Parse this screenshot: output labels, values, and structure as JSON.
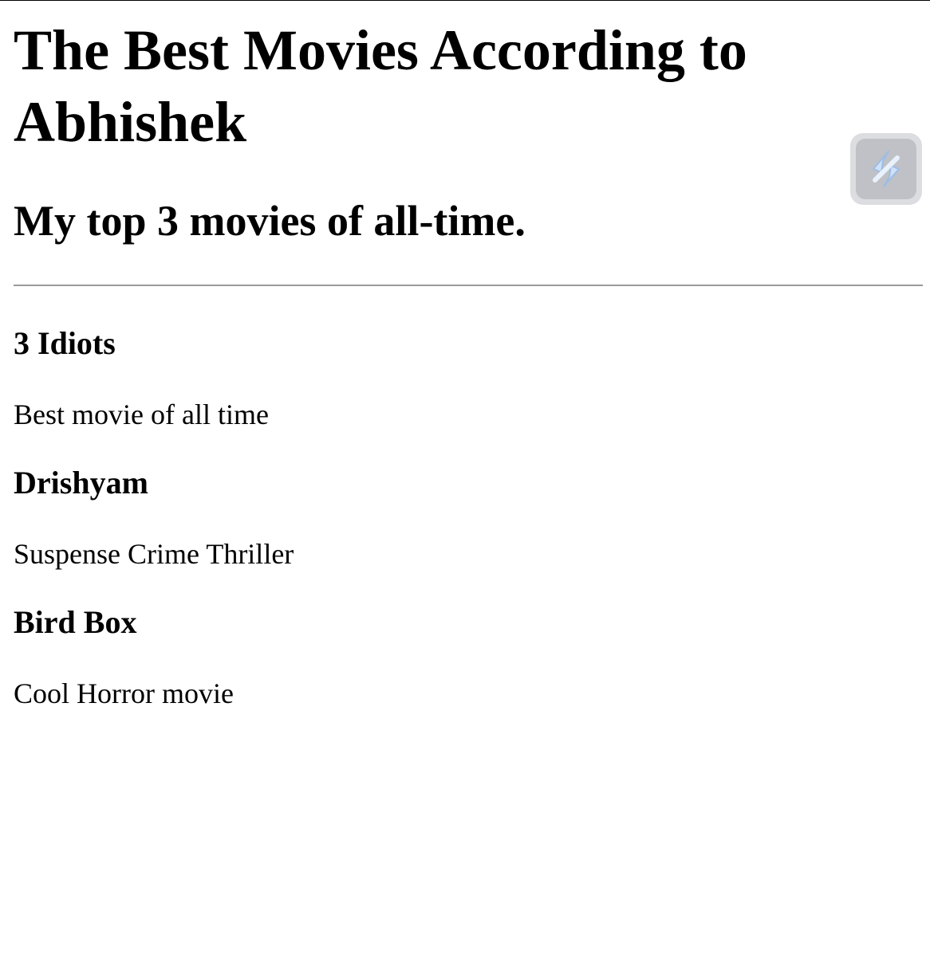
{
  "page": {
    "title": "The Best Movies According to Abhishek",
    "subtitle": "My top 3 movies of all-time."
  },
  "movies": [
    {
      "title": "3 Idiots",
      "description": "Best movie of all time"
    },
    {
      "title": "Drishyam",
      "description": "Suspense Crime Thriller"
    },
    {
      "title": "Bird Box",
      "description": "Cool Horror movie"
    }
  ],
  "widget": {
    "icon": "extension-lightning-icon",
    "accent_color": "#a9c8ee"
  }
}
